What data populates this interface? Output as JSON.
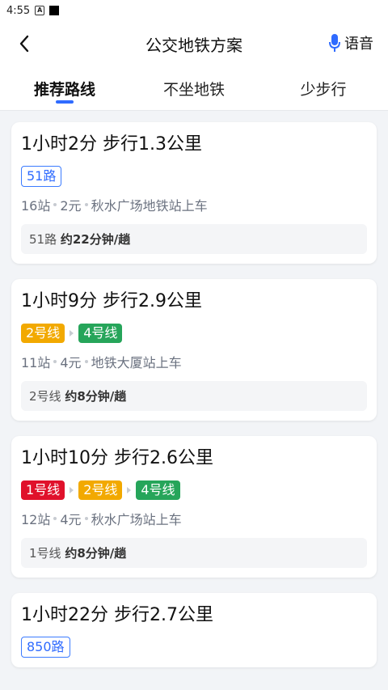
{
  "status": {
    "time": "4:55",
    "a_icon": "A"
  },
  "header": {
    "title": "公交地铁方案",
    "voice_label": "语音"
  },
  "tabs": [
    "推荐路线",
    "不坐地铁",
    "少步行"
  ],
  "routes": [
    {
      "title": "1小时2分  步行1.3公里",
      "lines": [
        {
          "name": "51路",
          "style": "outline"
        }
      ],
      "stops": "16站",
      "price": "2元",
      "board": "秋水广场地铁站上车",
      "freq_line": "51路",
      "freq_text": "约22分钟/趟"
    },
    {
      "title": "1小时9分  步行2.9公里",
      "lines": [
        {
          "name": "2号线",
          "style": "yellow"
        },
        {
          "name": "4号线",
          "style": "green"
        }
      ],
      "stops": "11站",
      "price": "4元",
      "board": "地铁大厦站上车",
      "freq_line": "2号线",
      "freq_text": "约8分钟/趟"
    },
    {
      "title": "1小时10分  步行2.6公里",
      "lines": [
        {
          "name": "1号线",
          "style": "red"
        },
        {
          "name": "2号线",
          "style": "yellow"
        },
        {
          "name": "4号线",
          "style": "green"
        }
      ],
      "stops": "12站",
      "price": "4元",
      "board": "秋水广场站上车",
      "freq_line": "1号线",
      "freq_text": "约8分钟/趟"
    },
    {
      "title": "1小时22分  步行2.7公里",
      "lines": [
        {
          "name": "850路",
          "style": "outline"
        }
      ]
    }
  ],
  "colors": {
    "accent": "#2f6bff",
    "line1": "#e0112b",
    "line2": "#f2a900",
    "line4": "#26a55a"
  }
}
